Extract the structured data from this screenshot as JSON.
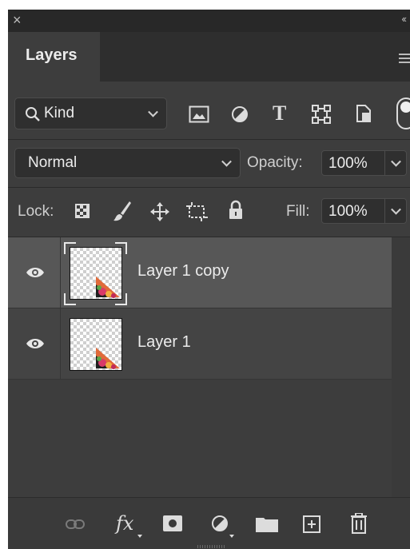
{
  "panel": {
    "tab_label": "Layers",
    "close_glyph": "×",
    "collapse_glyph": "‹‹"
  },
  "filter": {
    "kind_label": "Kind",
    "icons": [
      "search-icon",
      "image-filter-icon",
      "adjustment-filter-icon",
      "type-filter-icon",
      "shape-filter-icon",
      "smart-object-filter-icon"
    ]
  },
  "blend": {
    "mode": "Normal",
    "opacity_label": "Opacity:",
    "opacity_value": "100%"
  },
  "lock": {
    "label": "Lock:",
    "fill_label": "Fill:",
    "fill_value": "100%"
  },
  "layers": [
    {
      "name": "Layer 1 copy",
      "visible": true,
      "selected": true
    },
    {
      "name": "Layer 1",
      "visible": true,
      "selected": false
    }
  ],
  "footer": {
    "icons": [
      "link-icon",
      "fx-icon",
      "mask-icon",
      "adjustment-layer-icon",
      "folder-icon",
      "new-layer-icon",
      "trash-icon"
    ],
    "fx_label": "fx"
  }
}
